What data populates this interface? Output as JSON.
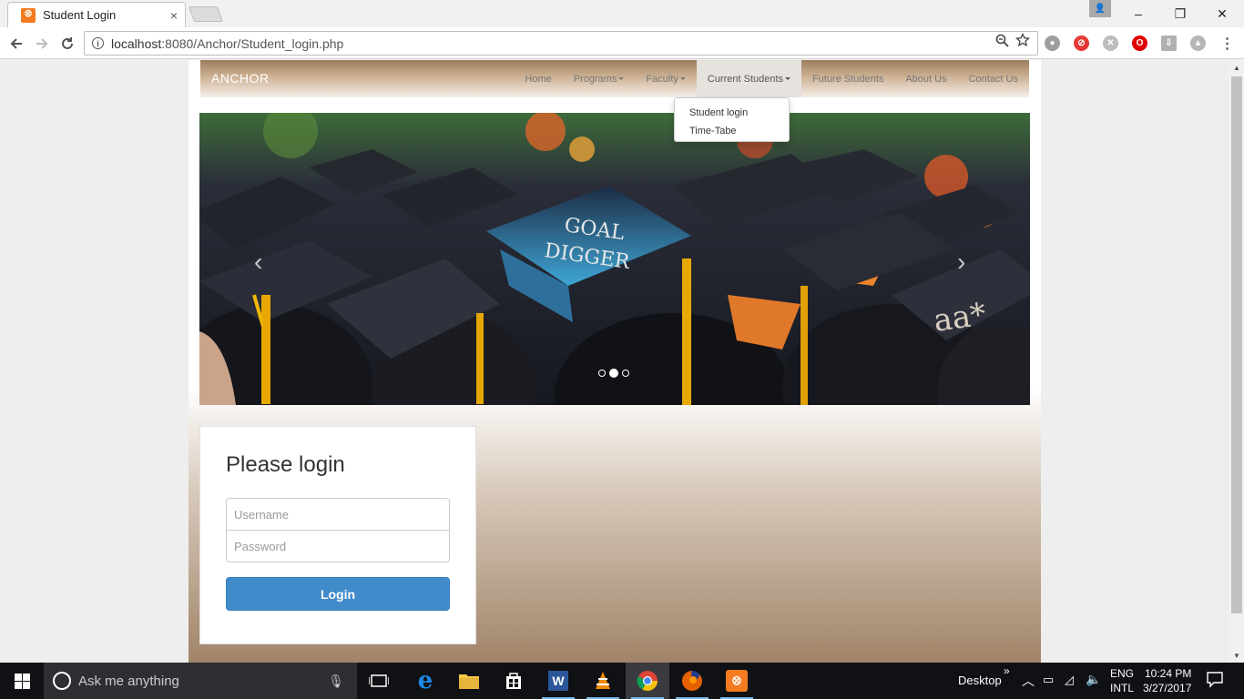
{
  "browser": {
    "tab_title": "Student Login",
    "tab_close": "×",
    "url_host": "localhost",
    "url_path": ":8080/Anchor/Student_login.php",
    "window_controls": [
      "–",
      "❐",
      "✕"
    ]
  },
  "site": {
    "brand": "ANCHOR",
    "nav": [
      {
        "label": "Home",
        "dropdown": false
      },
      {
        "label": "Programs",
        "dropdown": true
      },
      {
        "label": "Faculty",
        "dropdown": true
      },
      {
        "label": "Current Students",
        "dropdown": true,
        "active": true
      },
      {
        "label": "Future Students",
        "dropdown": false
      },
      {
        "label": "About Us",
        "dropdown": false
      },
      {
        "label": "Contact Us",
        "dropdown": false
      }
    ],
    "dropdown_items": [
      "Student login",
      "Time-Tabe"
    ],
    "carousel": {
      "prev": "‹",
      "next": "›",
      "slide_count": 3,
      "active_slide": 1,
      "caption_cap_text_1": "GOAL",
      "caption_cap_text_2": "DIGGER",
      "cap_text_right": "aa*"
    },
    "login": {
      "heading": "Please login",
      "username_placeholder": "Username",
      "password_placeholder": "Password",
      "button_label": "Login"
    }
  },
  "taskbar": {
    "search_placeholder": "Ask me anything",
    "desktop_label": "Desktop",
    "chevron": "»",
    "lang_top": "ENG",
    "lang_bottom": "INTL",
    "time": "10:24 PM",
    "date": "3/27/2017"
  },
  "colors": {
    "accent_blue": "#428bca",
    "nav_brown": "#9c7d5c",
    "xampp_orange": "#f47b20"
  }
}
